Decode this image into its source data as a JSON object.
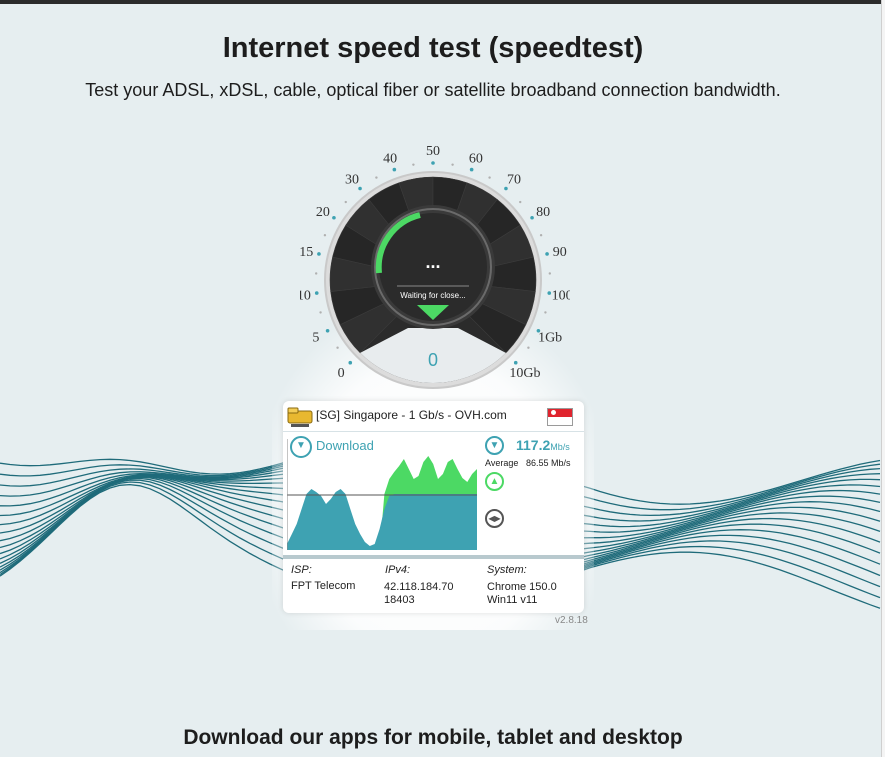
{
  "page": {
    "title": "Internet speed test (speedtest)",
    "subtitle": "Test your ADSL, xDSL, cable, optical fiber or satellite broadband connection bandwidth.",
    "apps_heading": "Download our apps for mobile, tablet and desktop",
    "version": "v2.8.18"
  },
  "gauge": {
    "scale_labels": [
      "0",
      "5",
      "10",
      "15",
      "20",
      "30",
      "40",
      "50",
      "60",
      "70",
      "80",
      "90",
      "100",
      "1Gb",
      "10Gb"
    ],
    "center_dots": "...",
    "status_text": "Waiting for close...",
    "current_value": "0",
    "accent_color": "#4cd964",
    "face_color": "#2b2b2b"
  },
  "server": {
    "name": "[SG] Singapore - 1 Gb/s - OVH.com",
    "flag_icon": "singapore-flag-icon"
  },
  "results": {
    "download_label": "Download",
    "download_speed": "117.2",
    "download_unit": "Mb/s",
    "average_label": "Average",
    "average_value": "86.55 Mb/s",
    "download_color": "#3ea2b2",
    "upload_color": "#4cd964"
  },
  "info": {
    "isp_label": "ISP:",
    "isp_value": "FPT Telecom",
    "ipv4_label": "IPv4:",
    "ipv4_value_line1": "42.118.184.70",
    "ipv4_value_line2": "18403",
    "system_label": "System:",
    "system_value_line1": "Chrome 150.0",
    "system_value_line2": "Win11 v11"
  }
}
